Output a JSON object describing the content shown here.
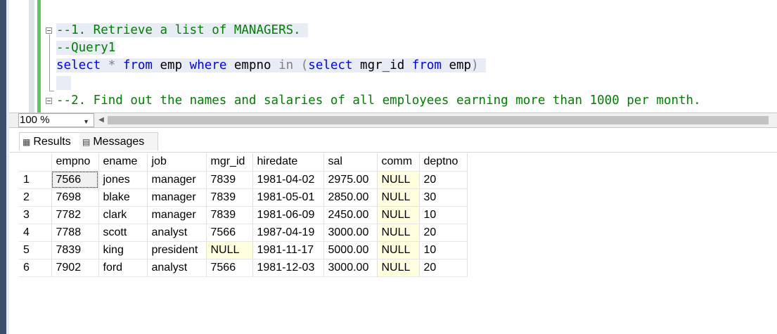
{
  "editor": {
    "line1_comment": "--1. Retrieve a list of MANAGERS. ",
    "line2_comment": "--Query1",
    "line3": {
      "kw_select": "select",
      "star": " * ",
      "kw_from": "from",
      "t_emp": " emp ",
      "kw_where": "where",
      "t_empno": " empno ",
      "kw_in": "in",
      "open": " (",
      "kw_select2": "select",
      "t_mgr": " mgr_id ",
      "kw_from2": "from",
      "t_emp2": " emp",
      "close": ") "
    },
    "line5_comment": "--2. Find out the names and salaries of all employees earning more than 1000 per month."
  },
  "zoom": {
    "value": "100 %"
  },
  "tabs": {
    "results": "Results",
    "messages": "Messages"
  },
  "results": {
    "columns": [
      "empno",
      "ename",
      "job",
      "mgr_id",
      "hiredate",
      "sal",
      "comm",
      "deptno"
    ],
    "rows": [
      [
        "1",
        "7566",
        "jones",
        "manager",
        "7839",
        "1981-04-02",
        "2975.00",
        "NULL",
        "20"
      ],
      [
        "2",
        "7698",
        "blake",
        "manager",
        "7839",
        "1981-05-01",
        "2850.00",
        "NULL",
        "30"
      ],
      [
        "3",
        "7782",
        "clark",
        "manager",
        "7839",
        "1981-06-09",
        "2450.00",
        "NULL",
        "10"
      ],
      [
        "4",
        "7788",
        "scott",
        "analyst",
        "7566",
        "1987-04-19",
        "3000.00",
        "NULL",
        "20"
      ],
      [
        "5",
        "7839",
        "king",
        "president",
        "NULL",
        "1981-11-17",
        "5000.00",
        "NULL",
        "10"
      ],
      [
        "6",
        "7902",
        "ford",
        "analyst",
        "7566",
        "1981-12-03",
        "3000.00",
        "NULL",
        "20"
      ]
    ]
  },
  "colors": {
    "keyword": "#0000ff",
    "comment": "#008000",
    "null_bg": "#ffffe0"
  }
}
